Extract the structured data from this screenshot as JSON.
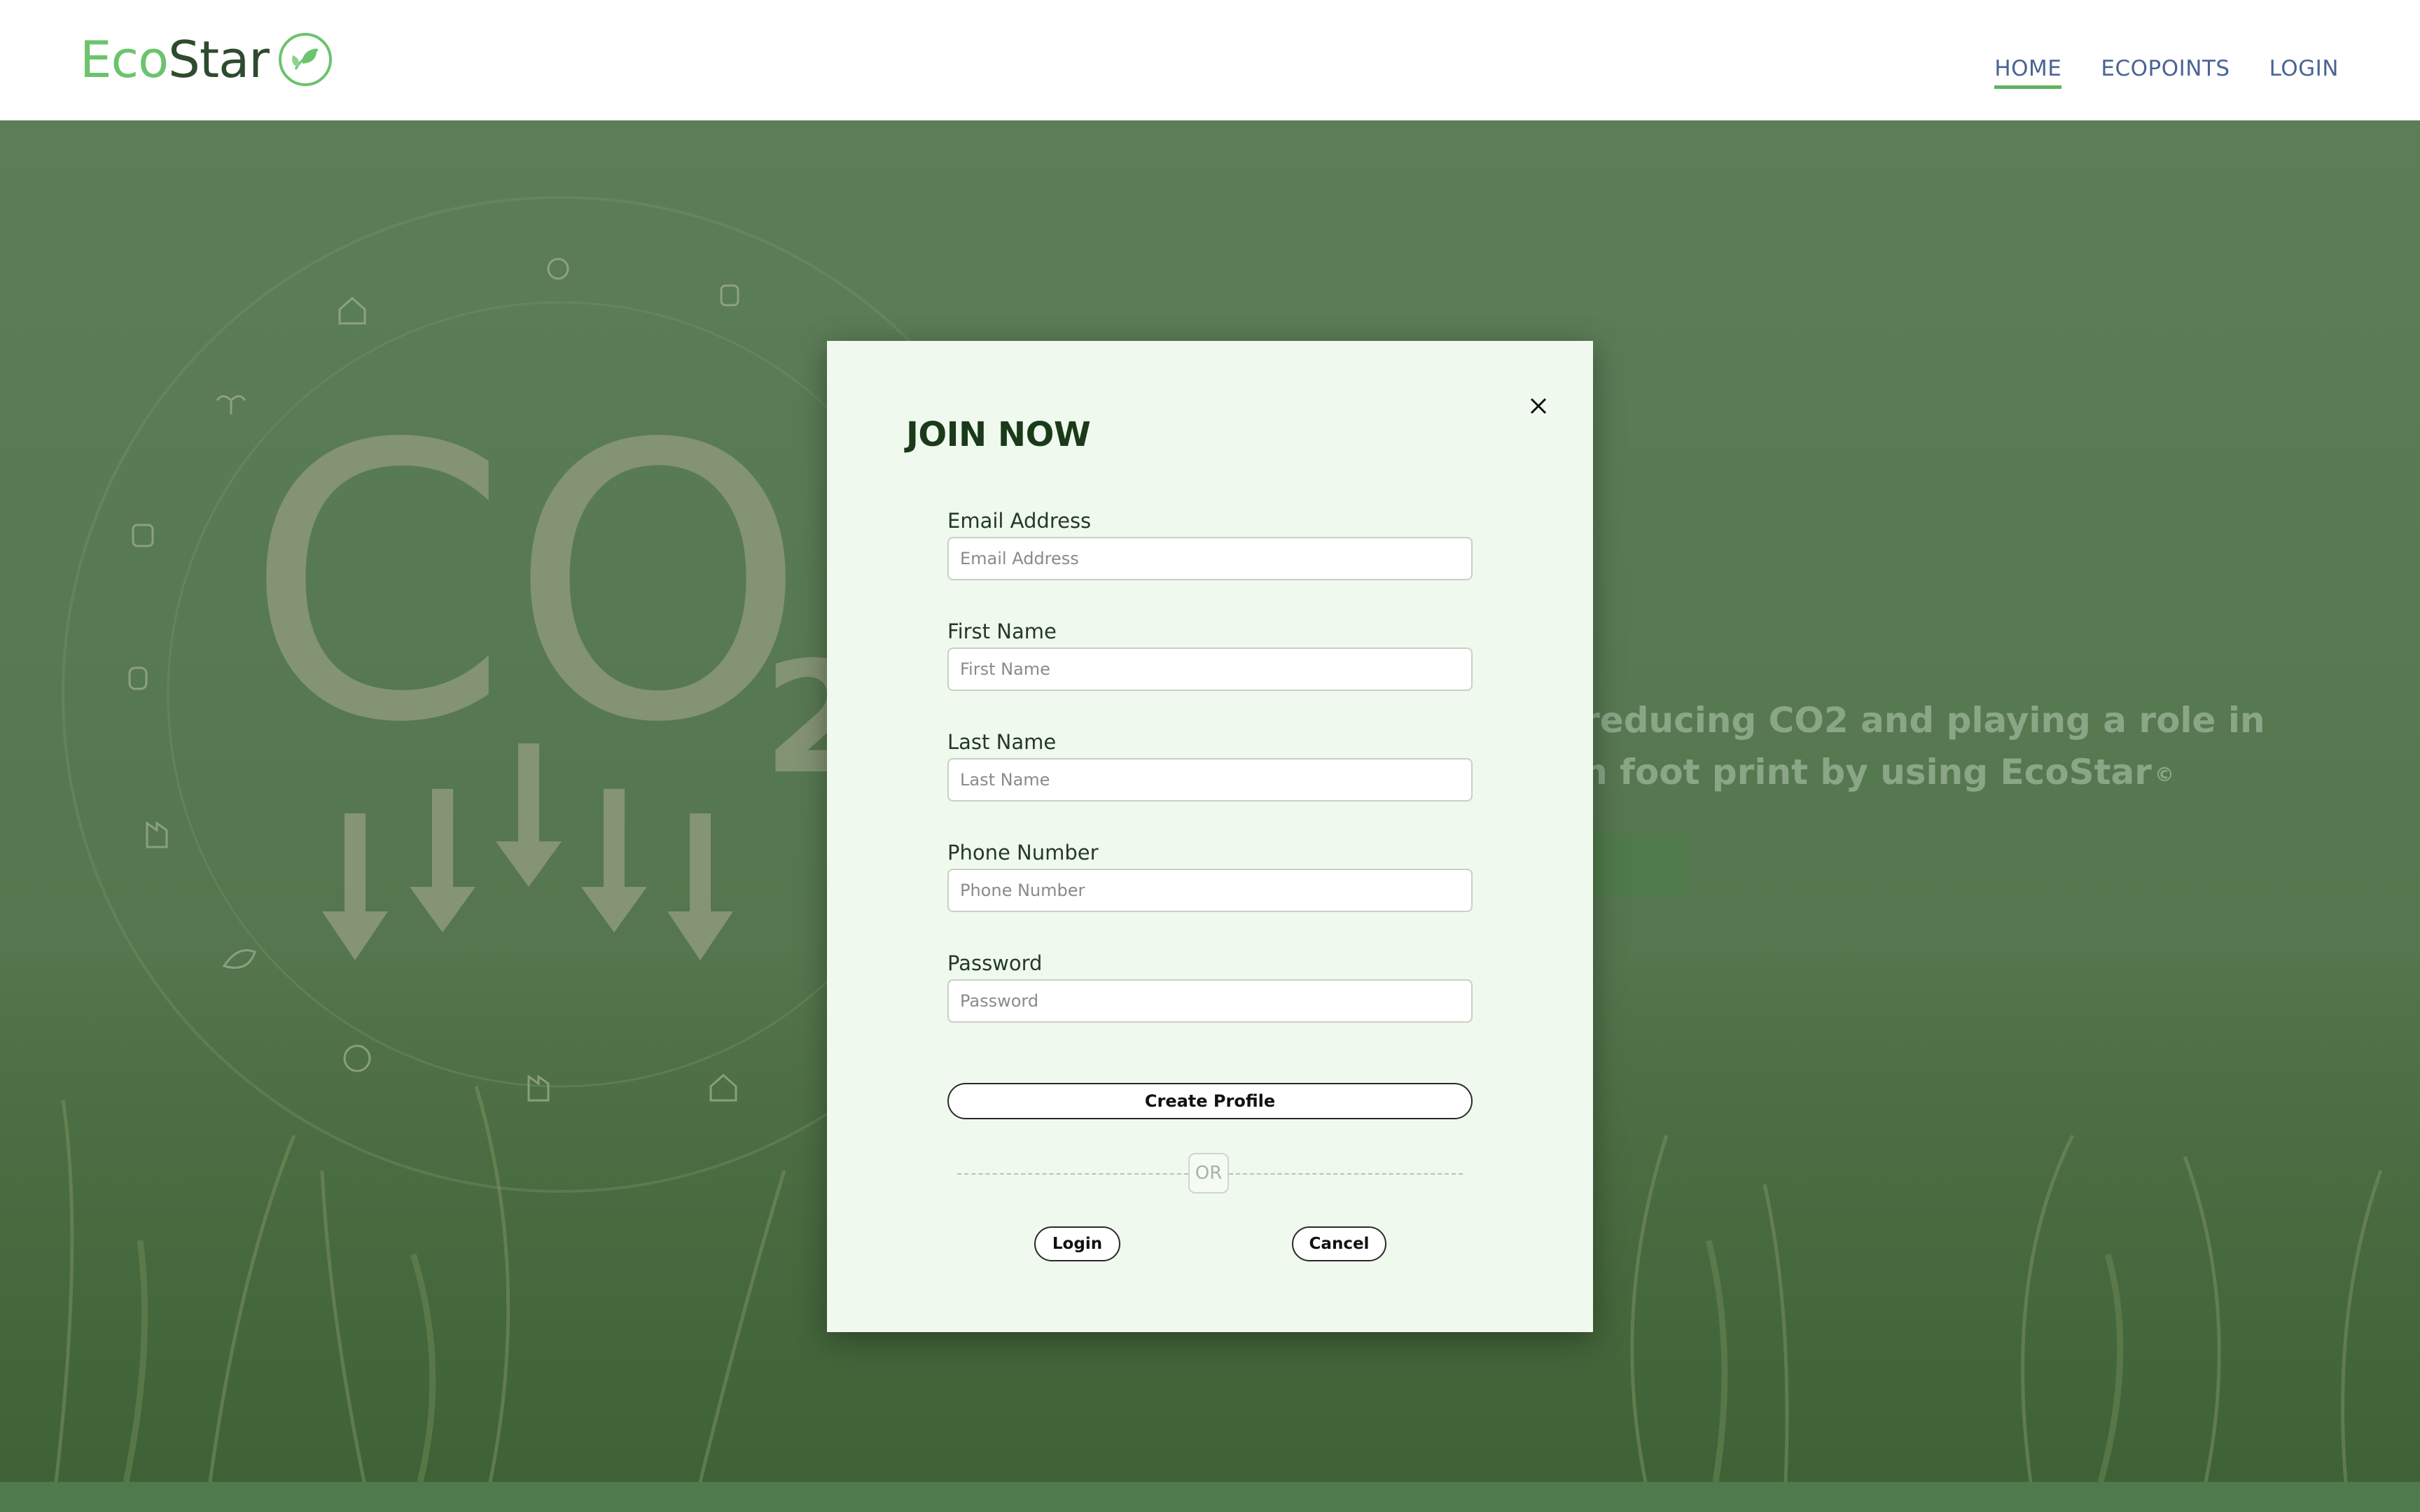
{
  "header": {
    "logo_eco": "Eco",
    "logo_star": "Star",
    "nav": [
      {
        "label": "HOME",
        "active": true
      },
      {
        "label": "ECOPOINTS",
        "active": false
      },
      {
        "label": "LOGIN",
        "active": false
      }
    ]
  },
  "hero": {
    "co2_letters": "CO",
    "co2_subscript": "2",
    "text_line1": "in reducing CO2 and playing a role in",
    "text_line2": "bon foot print by using EcoStar",
    "trademark": "©"
  },
  "modal": {
    "title": "JOIN NOW",
    "close_symbol": "×",
    "fields": [
      {
        "label": "Email Address",
        "placeholder": "Email Address",
        "value": ""
      },
      {
        "label": "First Name",
        "placeholder": "First Name",
        "value": ""
      },
      {
        "label": "Last Name",
        "placeholder": "Last Name",
        "value": ""
      },
      {
        "label": "Phone Number",
        "placeholder": "Phone Number",
        "value": ""
      },
      {
        "label": "Password",
        "placeholder": "Password",
        "value": ""
      }
    ],
    "create_button": "Create Profile",
    "or_text": "OR",
    "login_button": "Login",
    "cancel_button": "Cancel"
  },
  "colors": {
    "brand_green": "#6cc36e",
    "nav_blue": "#4b6395",
    "modal_bg": "#f0f9ee",
    "title_dark_green": "#1a3a1a"
  }
}
